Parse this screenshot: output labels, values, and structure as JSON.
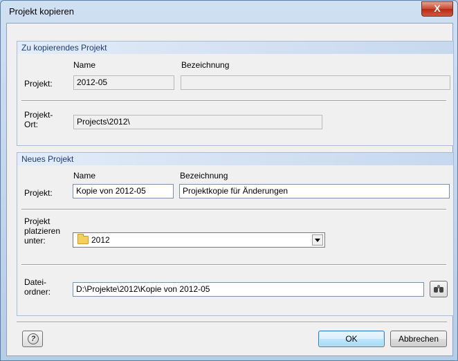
{
  "window": {
    "title": "Projekt kopieren",
    "close_glyph": "X"
  },
  "source_group": {
    "header": "Zu kopierendes Projekt",
    "col_name": "Name",
    "col_description": "Bezeichnung",
    "project_label": "Projekt:",
    "project_name": "2012-05",
    "project_description": "",
    "location_label_line1": "Projekt-",
    "location_label_line2": "Ort:",
    "location_value": "Projects\\2012\\"
  },
  "new_group": {
    "header": "Neues Projekt",
    "col_name": "Name",
    "col_description": "Bezeichnung",
    "project_label": "Projekt:",
    "project_name": "Kopie von 2012-05",
    "project_description": "Projektkopie für Änderungen",
    "place_label_line1": "Projekt",
    "place_label_line2": "platzieren",
    "place_label_line3": "unter:",
    "place_value": "2012",
    "folder_label_line1": "Datei-",
    "folder_label_line2": "ordner:",
    "folder_value": "D:\\Projekte\\2012\\Kopie von 2012-05"
  },
  "buttons": {
    "ok": "OK",
    "cancel": "Abbrechen"
  },
  "icons": [
    "close-icon",
    "folder-icon",
    "chevron-down-icon",
    "binoculars-icon",
    "help-icon"
  ]
}
